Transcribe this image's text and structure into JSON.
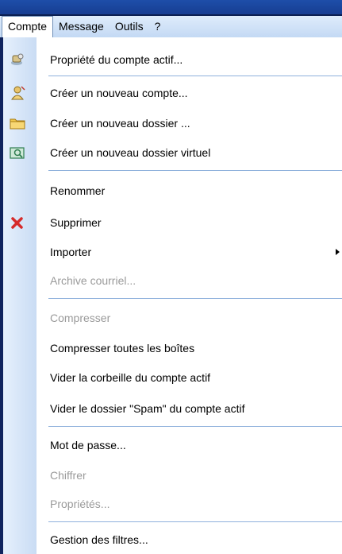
{
  "menubar": {
    "items": [
      {
        "label": "Compte"
      },
      {
        "label": "Message"
      },
      {
        "label": "Outils"
      },
      {
        "label": "?"
      }
    ]
  },
  "menu": {
    "items": [
      {
        "label": "Propriété du compte actif...",
        "icon": "account-properties-icon",
        "enabled": true
      },
      {
        "label": "Créer un nouveau compte...",
        "icon": "new-account-icon",
        "enabled": true
      },
      {
        "label": "Créer un nouveau dossier ...",
        "icon": "folder-icon",
        "enabled": true
      },
      {
        "label": "Créer un nouveau dossier virtuel",
        "icon": "virtual-folder-icon",
        "enabled": true
      },
      {
        "label": "Renommer",
        "icon": "",
        "enabled": true
      },
      {
        "label": "Supprimer",
        "icon": "delete-icon",
        "enabled": true
      },
      {
        "label": "Importer",
        "icon": "",
        "enabled": true,
        "submenu": true
      },
      {
        "label": "Archive courriel...",
        "icon": "",
        "enabled": false
      },
      {
        "label": "Compresser",
        "icon": "",
        "enabled": false
      },
      {
        "label": "Compresser toutes les boîtes",
        "icon": "",
        "enabled": true
      },
      {
        "label": "Vider la corbeille du compte actif",
        "icon": "",
        "enabled": true
      },
      {
        "label": "Vider le dossier \"Spam\" du compte actif",
        "icon": "",
        "enabled": true
      },
      {
        "label": "Mot de passe...",
        "icon": "",
        "enabled": true
      },
      {
        "label": "Chiffrer",
        "icon": "",
        "enabled": false
      },
      {
        "label": "Propriétés...",
        "icon": "",
        "enabled": false
      },
      {
        "label": "Gestion des filtres...",
        "icon": "",
        "enabled": true
      }
    ]
  },
  "colors": {
    "menubar_bg": "#c9dcf4",
    "menu_bg": "#ffffff",
    "gutter": "#d6e5f8",
    "separator": "#8fb1dc",
    "disabled_text": "#9a9a9a",
    "frame": "#10245e"
  }
}
